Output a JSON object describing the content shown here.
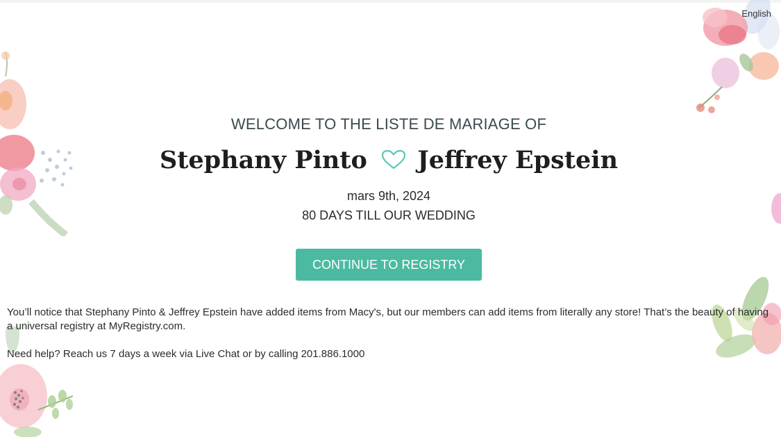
{
  "header": {
    "language_label": "English"
  },
  "main": {
    "welcome_text": "WELCOME TO THE LISTE DE MARIAGE OF",
    "partner_one": "Stephany Pinto",
    "partner_two": "Jeffrey Epstein",
    "date": "mars 9th, 2024",
    "countdown": "80 DAYS TILL OUR WEDDING",
    "continue_label": "CONTINUE TO REGISTRY"
  },
  "info": {
    "notice_text": "You’ll notice that Stephany Pinto & Jeffrey Epstein have added items from Macy's, but our members can add items from literally any store! That’s the beauty of having a universal registry at MyRegistry.com.",
    "help_text": "Need help? Reach us 7 days a week via Live Chat or by calling 201.886.1000"
  },
  "colors": {
    "accent": "#4bbaa0",
    "heart": "#5cc7b5",
    "welcome_text": "#3b4a4f",
    "button_text": "#ffffff"
  },
  "icons": {
    "heart": "heart-outline-icon"
  }
}
